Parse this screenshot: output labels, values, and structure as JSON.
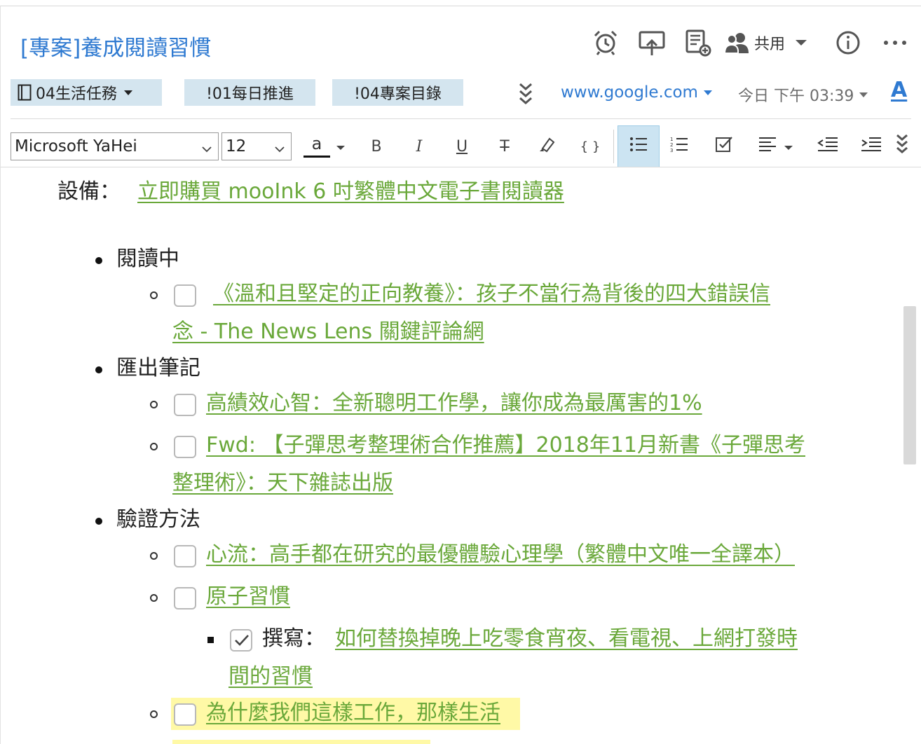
{
  "note": {
    "title": "[專案]養成閱讀習慣"
  },
  "header": {
    "icons": [
      "alarm-icon",
      "present-icon",
      "note-history-icon",
      "share-people-icon",
      "info-icon",
      "more-icon"
    ],
    "share_label": "共用"
  },
  "meta": {
    "notebook": "04生活任務",
    "tags": [
      "!01每日推進",
      "!04專案目錄"
    ],
    "source_url": "www.google.com",
    "date": "今日 下午 03:39",
    "format_label": "A"
  },
  "toolbar": {
    "font_family": "Microsoft YaHei",
    "font_size": "12",
    "text_color_label": "a",
    "bold": "B",
    "italic": "I",
    "underline": "U",
    "strike": "T",
    "code": "{ }"
  },
  "content": {
    "device_label": "設備：",
    "device_link": "立即購買 mooInk 6 吋繁體中文電子書閱讀器",
    "sections": [
      {
        "heading": "閱讀中",
        "items": [
          {
            "line1": "《溫和且堅定的正向教養》：孩子不當行為背後的四大錯誤信",
            "line2": "念 - The News Lens 關鍵評論網",
            "checked": false
          }
        ]
      },
      {
        "heading": "匯出筆記",
        "items": [
          {
            "line1": "高績效心智：全新聰明工作學，讓你成為最厲害的1%",
            "checked": false
          },
          {
            "line1": "Fwd: 【子彈思考整理術合作推薦】2018年11月新書《子彈思考",
            "line2": "整理術》：天下雜誌出版",
            "checked": false
          }
        ]
      },
      {
        "heading": "驗證方法",
        "items": [
          {
            "line1": "心流：高手都在研究的最優體驗心理學（繁體中文唯一全譯本）",
            "checked": false
          },
          {
            "line1": "原子習慣",
            "checked": false
          },
          {
            "prefix": "撰寫：",
            "line1": "如何替換掉晚上吃零食宵夜、看電視、上網打發時",
            "line2": "間的習慣",
            "checked": true
          },
          {
            "line1": "為什麼我們這樣工作，那樣生活",
            "checked": false,
            "highlight": "#fff9a6"
          }
        ]
      }
    ]
  },
  "colors": {
    "accent": "#2f7ad1",
    "link": "#6aa83a",
    "tag_bg": "#d4e5ef",
    "highlight": "#fff9a6"
  }
}
